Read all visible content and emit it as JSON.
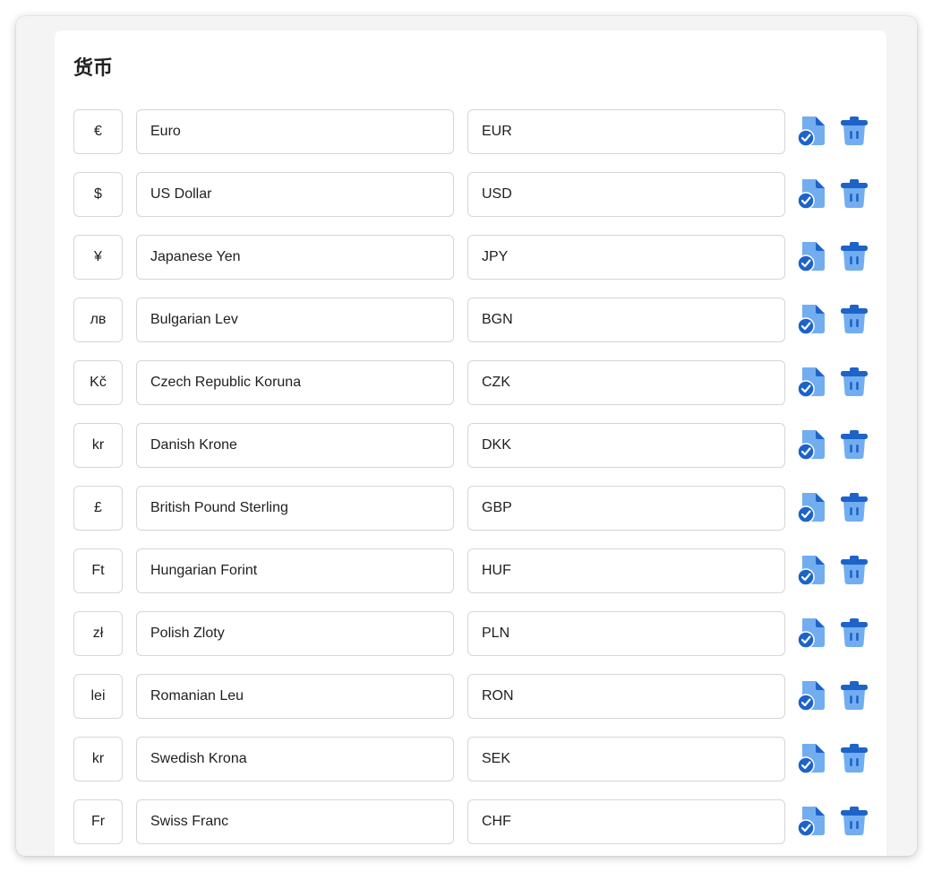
{
  "page": {
    "title": "货币"
  },
  "currencies": [
    {
      "symbol": "€",
      "name": "Euro",
      "code": "EUR"
    },
    {
      "symbol": "$",
      "name": "US Dollar",
      "code": "USD"
    },
    {
      "symbol": "¥",
      "name": "Japanese Yen",
      "code": "JPY"
    },
    {
      "symbol": "лв",
      "name": "Bulgarian Lev",
      "code": "BGN"
    },
    {
      "symbol": "Kč",
      "name": "Czech Republic Koruna",
      "code": "CZK"
    },
    {
      "symbol": "kr",
      "name": "Danish Krone",
      "code": "DKK"
    },
    {
      "symbol": "£",
      "name": "British Pound Sterling",
      "code": "GBP"
    },
    {
      "symbol": "Ft",
      "name": "Hungarian Forint",
      "code": "HUF"
    },
    {
      "symbol": "zł",
      "name": "Polish Zloty",
      "code": "PLN"
    },
    {
      "symbol": "lei",
      "name": "Romanian Leu",
      "code": "RON"
    },
    {
      "symbol": "kr",
      "name": "Swedish Krona",
      "code": "SEK"
    },
    {
      "symbol": "Fr",
      "name": "Swiss Franc",
      "code": "CHF"
    }
  ],
  "icons": {
    "save": "save-document-icon",
    "delete": "trash-icon"
  },
  "colors": {
    "icon_light": "#72adf0",
    "icon_dark": "#1d63c8",
    "border": "#d6d6d6",
    "window_bg": "#f4f4f4"
  }
}
